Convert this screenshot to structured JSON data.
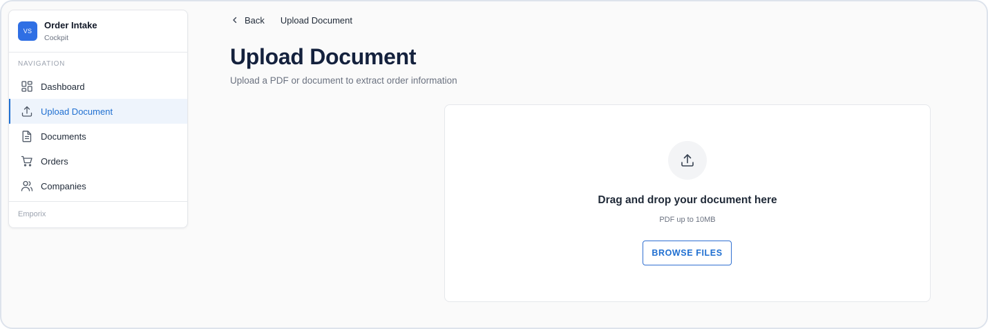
{
  "app": {
    "logo_initials": "VS",
    "title": "Order Intake",
    "subtitle": "Cockpit"
  },
  "sidebar": {
    "heading": "NAVIGATION",
    "items": [
      {
        "label": "Dashboard",
        "icon": "dashboard-icon",
        "active": false
      },
      {
        "label": "Upload Document",
        "icon": "upload-icon",
        "active": true
      },
      {
        "label": "Documents",
        "icon": "document-icon",
        "active": false
      },
      {
        "label": "Orders",
        "icon": "cart-icon",
        "active": false
      },
      {
        "label": "Companies",
        "icon": "users-icon",
        "active": false
      }
    ],
    "footer": "Emporix"
  },
  "header": {
    "back_label": "Back",
    "breadcrumb_current": "Upload Document"
  },
  "main": {
    "title": "Upload Document",
    "subtitle": "Upload a PDF or document to extract order information"
  },
  "dropzone": {
    "icon": "upload-icon",
    "title": "Drag and drop your document here",
    "hint": "PDF up to 10MB",
    "button_label": "BROWSE FILES"
  },
  "colors": {
    "accent": "#1f6fd1",
    "logo_bg": "#2f6fe4",
    "active_bg": "#eef4fc",
    "title": "#14213d"
  }
}
